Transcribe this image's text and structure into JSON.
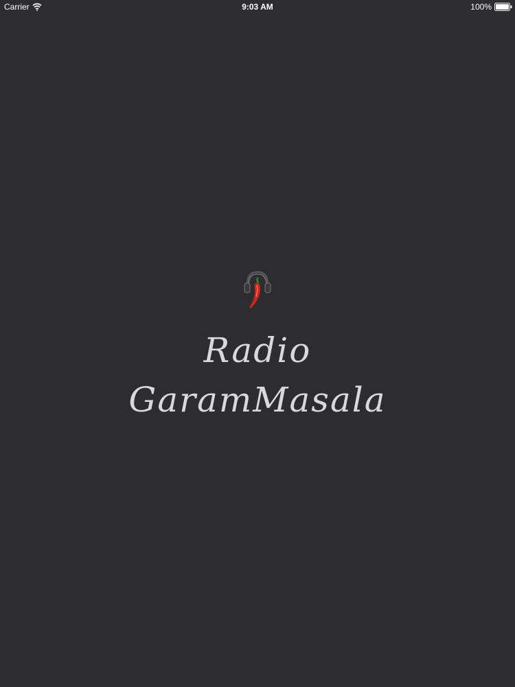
{
  "status_bar": {
    "carrier": "Carrier",
    "time": "9:03 AM",
    "battery": "100%"
  },
  "splash": {
    "logo_icon": "chili-headphones-icon",
    "title_line1": "Radio",
    "title_line2": "GaramMasala"
  },
  "colors": {
    "background": "#2d2c2e",
    "title": "#d9d9d9",
    "chili": "#c8261b"
  }
}
